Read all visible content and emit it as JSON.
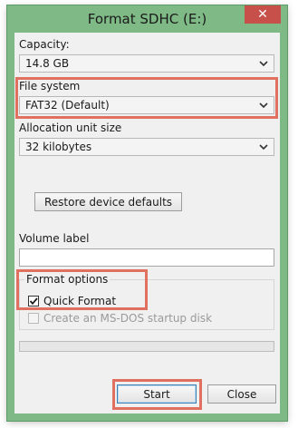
{
  "window": {
    "title": "Format SDHC (E:)",
    "close_glyph": "✕"
  },
  "capacity": {
    "label": "Capacity:",
    "value": "14.8 GB"
  },
  "file_system": {
    "label": "File system",
    "value": "FAT32 (Default)"
  },
  "allocation": {
    "label": "Allocation unit size",
    "value": "32 kilobytes"
  },
  "restore_button": {
    "label": "Restore device defaults"
  },
  "volume_label": {
    "label": "Volume label",
    "value": ""
  },
  "format_options": {
    "label": "Format options",
    "quick_format": {
      "label": "Quick Format",
      "checked": true
    },
    "msdos": {
      "label": "Create an MS-DOS startup disk",
      "checked": false,
      "enabled": false
    }
  },
  "progress": {
    "fraction": 0
  },
  "buttons": {
    "start": "Start",
    "close": "Close"
  },
  "colors": {
    "title_bar": "#7fba86",
    "close_button": "#c7504a",
    "highlight": "#e07060",
    "dialog_bg": "#f0f0f0"
  },
  "icons": {
    "close": "close-icon",
    "dropdown": "chevron-down-icon",
    "check": "checkmark-icon"
  }
}
